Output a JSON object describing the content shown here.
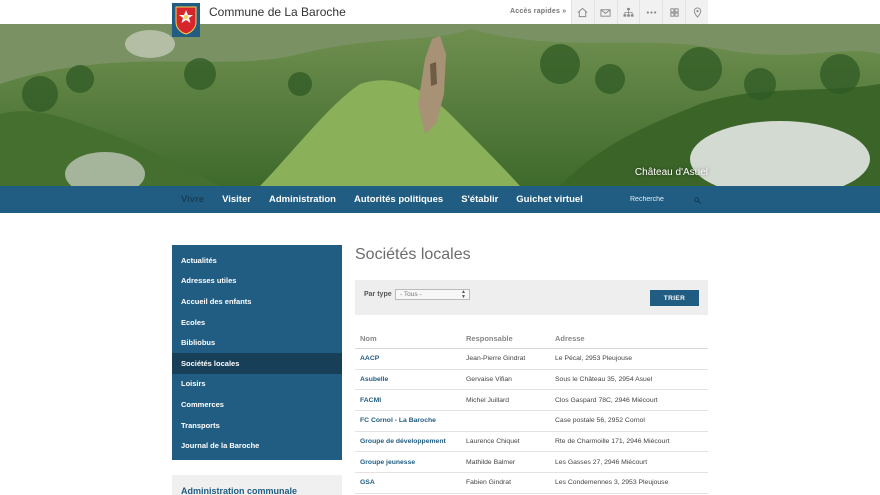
{
  "header": {
    "site_title": "Commune de La Baroche",
    "quick_access": "Accès rapides »",
    "quick_icons": [
      "home-icon",
      "mail-icon",
      "sitemap-icon",
      "more-icon",
      "grid-icon",
      "location-icon"
    ]
  },
  "hero": {
    "caption": "Château d'Asuel"
  },
  "nav": {
    "items": [
      "Vivre",
      "Visiter",
      "Administration",
      "Autorités politiques",
      "S'établir",
      "Guichet virtuel"
    ],
    "active_index": 0,
    "search_placeholder": "Recherche"
  },
  "sidebar": {
    "items": [
      "Actualités",
      "Adresses utiles",
      "Accueil des enfants",
      "Ecoles",
      "Bibliobus",
      "Sociétés locales",
      "Loisirs",
      "Commerces",
      "Transports",
      "Journal de la Baroche"
    ],
    "active_index": 5,
    "admin_title": "Administration communale"
  },
  "main": {
    "title": "Sociétés locales",
    "filter": {
      "label": "Par type",
      "selected": "- Tous -",
      "button": "TRIER"
    },
    "table": {
      "headers": [
        "Nom",
        "Responsable",
        "Adresse"
      ],
      "rows": [
        [
          "AACP",
          "Jean-Pierre Gindrat",
          "Le Pécal, 2953 Pleujouse"
        ],
        [
          "Asubelle",
          "Gervaise Vifian",
          "Sous le Château 35, 2954 Asuel"
        ],
        [
          "FACMI",
          "Michel Juillard",
          "Clos Gaspard 78C, 2946 Miécourt"
        ],
        [
          "FC Cornol - La Baroche",
          "",
          "Case postale 56, 2952 Cornol"
        ],
        [
          "Groupe de développement",
          "Laurence Chiquet",
          "Rte de Charmoille 171, 2946 Miécourt"
        ],
        [
          "Groupe jeunesse",
          "Mathilde Balmer",
          "Les Gasses 27, 2946 Miécourt"
        ],
        [
          "GSA",
          "Fabien Gindrat",
          "Les Condemennes 3, 2953 Pleujouse"
        ]
      ]
    }
  },
  "colors": {
    "primary": "#215d82",
    "primary_dark": "#183f58",
    "filter_bg": "#eeeeee"
  }
}
